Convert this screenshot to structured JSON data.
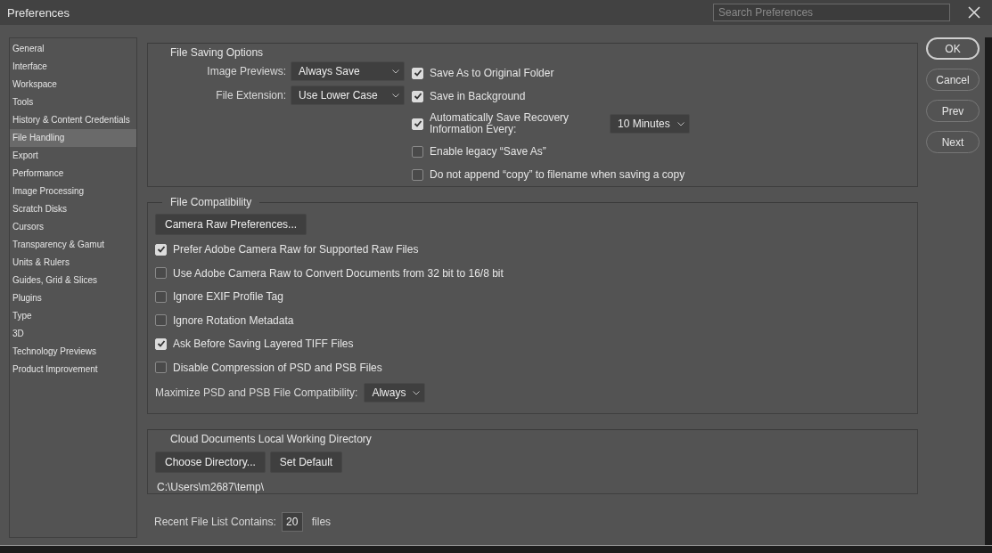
{
  "window": {
    "title": "Preferences"
  },
  "search": {
    "placeholder": "Search Preferences"
  },
  "sidebar": {
    "items": [
      {
        "label": "General",
        "selected": false
      },
      {
        "label": "Interface",
        "selected": false
      },
      {
        "label": "Workspace",
        "selected": false
      },
      {
        "label": "Tools",
        "selected": false
      },
      {
        "label": "History & Content Credentials",
        "selected": false
      },
      {
        "label": "File Handling",
        "selected": true
      },
      {
        "label": "Export",
        "selected": false
      },
      {
        "label": "Performance",
        "selected": false
      },
      {
        "label": "Image Processing",
        "selected": false
      },
      {
        "label": "Scratch Disks",
        "selected": false
      },
      {
        "label": "Cursors",
        "selected": false
      },
      {
        "label": "Transparency & Gamut",
        "selected": false
      },
      {
        "label": "Units & Rulers",
        "selected": false
      },
      {
        "label": "Guides, Grid & Slices",
        "selected": false
      },
      {
        "label": "Plugins",
        "selected": false
      },
      {
        "label": "Type",
        "selected": false
      },
      {
        "label": "3D",
        "selected": false
      },
      {
        "label": "Technology Previews",
        "selected": false
      },
      {
        "label": "Product Improvement",
        "selected": false
      }
    ]
  },
  "file_saving_options": {
    "title": "File Saving Options",
    "dropdowns": [
      {
        "label": "Image Previews:",
        "value": "Always Save"
      },
      {
        "label": "File Extension:",
        "value": "Use Lower Case"
      }
    ],
    "options": [
      {
        "label": "Save As to Original Folder",
        "checked": true
      },
      {
        "label": "Save in Background",
        "checked": true
      },
      {
        "label": "Automatically Save Recovery Information Every:",
        "checked": true,
        "interval": "10 Minutes"
      },
      {
        "label": "Enable legacy “Save As”",
        "checked": false
      },
      {
        "label": "Do not append “copy” to filename when saving a copy",
        "checked": false
      }
    ]
  },
  "file_compatibility": {
    "title": "File Compatibility",
    "button": "Camera Raw Preferences...",
    "options": [
      {
        "label": "Prefer Adobe Camera Raw for Supported Raw Files",
        "checked": true
      },
      {
        "label": "Use Adobe Camera Raw to Convert Documents from 32 bit to 16/8 bit",
        "checked": false
      },
      {
        "label": "Ignore EXIF Profile Tag",
        "checked": false
      },
      {
        "label": "Ignore Rotation Metadata",
        "checked": false
      },
      {
        "label": "Ask Before Saving Layered TIFF Files",
        "checked": true
      },
      {
        "label": "Disable Compression of PSD and PSB Files",
        "checked": false
      }
    ],
    "maximize": {
      "label": "Maximize PSD and PSB File Compatibility:",
      "value": "Always"
    }
  },
  "cloud_documents": {
    "title": "Cloud Documents Local Working Directory",
    "buttons": [
      "Choose Directory...",
      "Set Default"
    ],
    "path": "C:\\Users\\m2687\\temp\\"
  },
  "recent_files": {
    "label": "Recent File List Contains:",
    "value": "20",
    "unit": "files"
  },
  "buttons": [
    {
      "label": "OK",
      "default": true
    },
    {
      "label": "Cancel",
      "default": false
    },
    {
      "label": "Prev",
      "default": false
    },
    {
      "label": "Next",
      "default": false
    }
  ]
}
